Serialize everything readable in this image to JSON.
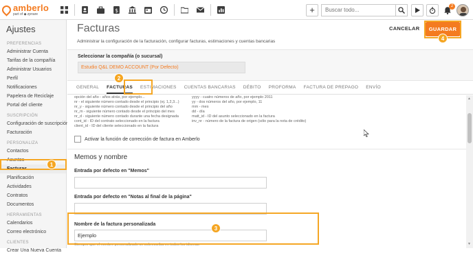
{
  "app": {
    "logo_name": "amberlo",
    "logo_sub": "part of ◆ zpnare",
    "nav_icons": [
      "grid-icon",
      "contacts-icon",
      "briefcase-icon",
      "invoice-icon",
      "bank-icon",
      "calendar-icon",
      "history-icon",
      "folder-icon",
      "mail-icon",
      "reports-icon"
    ],
    "add_label": "+",
    "search_placeholder": "Buscar todo...",
    "notification_count": "2"
  },
  "sidebar": {
    "title": "Ajustes",
    "sections": [
      {
        "heading": "PREFERENCIAS",
        "items": [
          "Administrar Cuenta",
          "Tarifas de la compañía",
          "Administrar Usuarios",
          "Perfil",
          "Notificaciones",
          "Papelera de Reciclaje",
          "Portal del cliente"
        ]
      },
      {
        "heading": "SUSCRIPCIÓN",
        "items": [
          "Configuración de suscripción",
          "Facturación"
        ]
      },
      {
        "heading": "PERSONALIZA",
        "items": [
          "Contactos",
          "Asuntos",
          "Facturas",
          "Planificación",
          "Actividades",
          "Contratos",
          "Documentos"
        ]
      },
      {
        "heading": "HERRAMIENTAS",
        "items": [
          "Calendarios",
          "Correo electrónico"
        ]
      },
      {
        "heading": "CLIENTES",
        "items": [
          "Crear Una Nueva Cuenta"
        ]
      }
    ],
    "active_item": "Facturas"
  },
  "main": {
    "title": "Facturas",
    "description": "Administrar la configuración de la facturación, configurar facturas, estimaciones y cuentas bancarias",
    "cancel_label": "CANCELAR",
    "save_label": "GUARDAR",
    "company_label": "Seleccionar la compañía (o sucursal)",
    "company_value": "Estudio Q&L DEMO ACCOUNT (Por Defecto)",
    "tabs": [
      "GENERAL",
      "FACTURAS",
      "ESTIMACIONES",
      "CUENTAS BANCARIAS",
      "DÉBITO",
      "PROFORMA",
      "FACTURA DE PREPAGO",
      "ENVÍO"
    ],
    "active_tab": "FACTURAS",
    "codes": [
      {
        "left": "opción del año - años atrás, por ejemplo...",
        "right": "yyyy - cuatro números de año, por ejemplo 2011"
      },
      {
        "left": "nr - el siguiente número contado desde el principio (ej. 1,2,3...)",
        "right": "yy - dos números del año, por ejemplo, 11"
      },
      {
        "left": "nr_y - siguiente número contado desde el principio del año",
        "right": "mm - mes"
      },
      {
        "left": "nr_m - siguiente número contado desde el principio del mes",
        "right": "dd - día"
      },
      {
        "left": "nr_d - siguiente número contado durante una fecha designada",
        "right": "matt_id - ID del asunto seleccionado en la factura"
      },
      {
        "left": "cont_id - ID del contrato seleccionado en la factura",
        "right": "inv_nr - número de la factura de origen (sólo para la nota de crédito)"
      },
      {
        "left": "client_id - ID del cliente seleccionado en la factura",
        "right": ""
      }
    ],
    "correction_label": "Activar la función de corrección de factura en Amberlo",
    "section_title": "Memos y nombre",
    "memos_label": "Entrada por defecto en \"Memos\"",
    "memos_value": "",
    "notes_label": "Entrada por defecto en \"Notas al final de la página\"",
    "notes_value": "",
    "custom_name_label": "Nombre de la factura personalizada",
    "custom_name_value": "Ejemplo",
    "custom_name_hint": "Siempre que el nombre personalizado se sobrescriba en todos los idiomas"
  },
  "callouts": {
    "one": "1",
    "two": "2",
    "three": "3",
    "four": "4"
  },
  "colors": {
    "accent": "#f47b20",
    "highlight": "#f5a623"
  }
}
